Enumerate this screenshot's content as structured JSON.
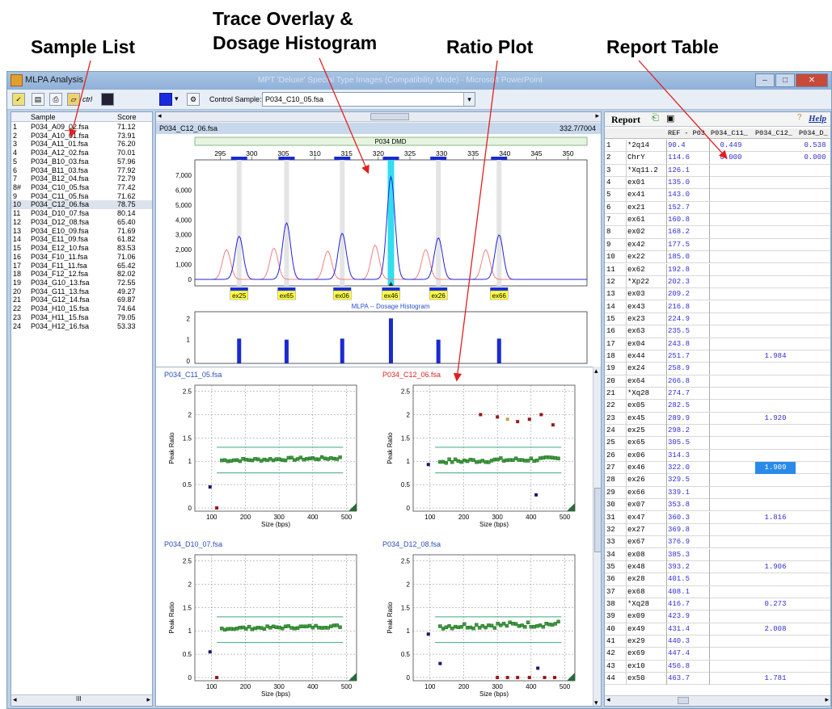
{
  "annotations": {
    "sample_list": "Sample List",
    "trace_line1": "Trace Overlay &",
    "trace_line2": "Dosage Histogram",
    "ratio_plot": "Ratio Plot",
    "report_table": "Report Table"
  },
  "window": {
    "title": "MLPA Analysis",
    "blurred_title": "MPT 'Deluxe' Special Type Images (Compatibility Mode) - Microsoft PowerPoint"
  },
  "toolbar": {
    "ctrl_label": "ctrl",
    "control_sample_label": "Control Sample:",
    "control_sample_value": "P034_C10_05.fsa"
  },
  "sample_list": {
    "headers": [
      "Sample",
      "Score"
    ],
    "rows": [
      [
        "1",
        "P034_A09_02.fsa",
        "71.12"
      ],
      [
        "2",
        "P034_A10_01.fsa",
        "73.91"
      ],
      [
        "3",
        "P034_A11_01.fsa",
        "76.20"
      ],
      [
        "4",
        "P034_A12_02.fsa",
        "70.01"
      ],
      [
        "5",
        "P034_B10_03.fsa",
        "57.96"
      ],
      [
        "6",
        "P034_B11_03.fsa",
        "77.92"
      ],
      [
        "7",
        "P034_B12_04.fsa",
        "72.79"
      ],
      [
        "8#",
        "P034_C10_05.fsa",
        "77.42"
      ],
      [
        "9",
        "P034_C11_05.fsa",
        "71.62"
      ],
      [
        "10",
        "P034_C12_06.fsa",
        "78.75"
      ],
      [
        "11",
        "P034_D10_07.fsa",
        "80.14"
      ],
      [
        "12",
        "P034_D12_08.fsa",
        "65.40"
      ],
      [
        "13",
        "P034_E10_09.fsa",
        "71.69"
      ],
      [
        "14",
        "P034_E11_09.fsa",
        "61.82"
      ],
      [
        "15",
        "P034_E12_10.fsa",
        "83.53"
      ],
      [
        "16",
        "P034_F10_11.fsa",
        "71.06"
      ],
      [
        "17",
        "P034_F11_11.fsa",
        "65.42"
      ],
      [
        "18",
        "P034_F12_12.fsa",
        "82.02"
      ],
      [
        "19",
        "P034_G10_13.fsa",
        "72.55"
      ],
      [
        "20",
        "P034_G11_13.fsa",
        "49.27"
      ],
      [
        "21",
        "P034_G12_14.fsa",
        "69.87"
      ],
      [
        "22",
        "P034_H10_15.fsa",
        "74.64"
      ],
      [
        "23",
        "P034_H11_15.fsa",
        "79.05"
      ],
      [
        "24",
        "P034_H12_16.fsa",
        "53.33"
      ]
    ],
    "selected_index": 9,
    "scroll_thumb": "III"
  },
  "trace": {
    "sample_name": "P034_C12_06.fsa",
    "counter": "332.7/7004",
    "panel_label": "P034 DMD",
    "x_ticks": [
      295,
      300,
      305,
      310,
      315,
      320,
      325,
      330,
      335,
      340,
      345,
      350
    ],
    "y_ticks": [
      "7,000",
      "6,000",
      "5,000",
      "4,000",
      "3,000",
      "2,000",
      "1,000",
      "0"
    ],
    "bins": [
      {
        "label": "ex25",
        "x": 298.0
      },
      {
        "label": "ex65",
        "x": 305.5
      },
      {
        "label": "ex06",
        "x": 314.3
      },
      {
        "label": "ex46",
        "x": 322.0
      },
      {
        "label": "ex26",
        "x": 329.5
      },
      {
        "label": "ex66",
        "x": 339.1
      }
    ],
    "highlight_x": 322.0,
    "red_peaks": [
      [
        296.0,
        2000
      ],
      [
        303.5,
        2100
      ],
      [
        312.0,
        1900
      ],
      [
        319.5,
        2300
      ],
      [
        327.5,
        2000
      ],
      [
        337.0,
        2000
      ]
    ],
    "blue_peaks": [
      [
        298.0,
        2900
      ],
      [
        305.5,
        3800
      ],
      [
        314.3,
        3100
      ],
      [
        322.0,
        6900
      ],
      [
        329.5,
        2800
      ],
      [
        339.1,
        3000
      ]
    ],
    "colors": {
      "red": "#f08080",
      "blue": "#2222dd",
      "highlight": "#33ddee",
      "bin_fill": "#ffff44"
    }
  },
  "histogram": {
    "title": "MLPA -- Dosage Histogram",
    "y_ticks": [
      "2",
      "1",
      "0"
    ],
    "bars": [
      {
        "x": 298.0,
        "v": 1.05
      },
      {
        "x": 305.5,
        "v": 1.0
      },
      {
        "x": 314.3,
        "v": 1.05
      },
      {
        "x": 322.0,
        "v": 2.0
      },
      {
        "x": 329.5,
        "v": 1.0
      },
      {
        "x": 339.1,
        "v": 1.05
      }
    ]
  },
  "ratio_plots": [
    {
      "title": "P034_C11_05.fsa",
      "title_color": "#2a4fb8",
      "outliers": [
        [
          95,
          0.45,
          "#1a1a6a"
        ],
        [
          115,
          0.0,
          "#9a1a1a"
        ]
      ],
      "green_base": 1.02,
      "green_var": 0.06
    },
    {
      "title": "P034_C12_06.fsa",
      "title_color": "#dd2222",
      "outliers": [
        [
          95,
          0.93,
          "#1a1a6a"
        ],
        [
          250,
          2.0,
          "#9a1a1a"
        ],
        [
          300,
          1.95,
          "#9a1a1a"
        ],
        [
          330,
          1.9,
          "#d0a040"
        ],
        [
          360,
          1.85,
          "#9a1a1a"
        ],
        [
          395,
          1.9,
          "#9a1a1a"
        ],
        [
          430,
          2.0,
          "#9a1a1a"
        ],
        [
          465,
          1.78,
          "#9a1a1a"
        ],
        [
          415,
          0.28,
          "#1a1a6a"
        ]
      ],
      "green_base": 1.0,
      "green_var": 0.09
    },
    {
      "title": "P034_D10_07.fsa",
      "title_color": "#2a4fb8",
      "outliers": [
        [
          95,
          0.55,
          "#1a1a6a"
        ],
        [
          115,
          0.0,
          "#9a1a1a"
        ]
      ],
      "green_base": 1.05,
      "green_var": 0.06
    },
    {
      "title": "P034_D12_08.fsa",
      "title_color": "#2a4fb8",
      "outliers": [
        [
          95,
          0.93,
          "#1a1a6a"
        ],
        [
          130,
          0.3,
          "#1a1a6a"
        ],
        [
          300,
          0.0,
          "#9a1a1a"
        ],
        [
          330,
          0.0,
          "#9a1a1a"
        ],
        [
          360,
          0.0,
          "#9a1a1a"
        ],
        [
          395,
          0.0,
          "#9a1a1a"
        ],
        [
          420,
          0.2,
          "#1a1a6a"
        ],
        [
          440,
          0.0,
          "#9a1a1a"
        ],
        [
          470,
          0.0,
          "#9a1a1a"
        ]
      ],
      "green_base": 1.1,
      "green_var": 0.12
    }
  ],
  "ratio_axis": {
    "ylabel": "Peak Ratio",
    "xlabel": "Size (bps)",
    "y_ticks": [
      "2.5",
      "2",
      "1.5",
      "1",
      "0.5",
      "0"
    ],
    "x_ticks": [
      "100",
      "200",
      "300",
      "400",
      "500"
    ],
    "ylim": [
      0,
      2.7
    ],
    "xlim": [
      50,
      530
    ],
    "band_upper": 1.3,
    "band_lower": 0.75
  },
  "report": {
    "title": "Report",
    "help": "Help",
    "headers": [
      "",
      "",
      "REF - P03",
      "P034_C11_",
      "P034_C12_",
      "P034_D_"
    ],
    "rows": [
      [
        "1",
        "*2q14",
        "90.4",
        "0.449",
        "",
        "0.538"
      ],
      [
        "2",
        "ChrY",
        "114.6",
        "0.000",
        "",
        "0.000"
      ],
      [
        "3",
        "*Xq11.2",
        "126.1",
        "",
        "",
        ""
      ],
      [
        "4",
        "ex01",
        "135.0",
        "",
        "",
        ""
      ],
      [
        "5",
        "ex41",
        "143.0",
        "",
        "",
        ""
      ],
      [
        "6",
        "ex21",
        "152.7",
        "",
        "",
        ""
      ],
      [
        "7",
        "ex61",
        "160.8",
        "",
        "",
        ""
      ],
      [
        "8",
        "ex02",
        "168.2",
        "",
        "",
        ""
      ],
      [
        "9",
        "ex42",
        "177.5",
        "",
        "",
        ""
      ],
      [
        "10",
        "ex22",
        "185.0",
        "",
        "",
        ""
      ],
      [
        "11",
        "ex62",
        "192.8",
        "",
        "",
        ""
      ],
      [
        "12",
        "*Xp22",
        "202.3",
        "",
        "",
        ""
      ],
      [
        "13",
        "ex03",
        "209.2",
        "",
        "",
        ""
      ],
      [
        "14",
        "ex43",
        "216.8",
        "",
        "",
        ""
      ],
      [
        "15",
        "ex23",
        "224.9",
        "",
        "",
        ""
      ],
      [
        "16",
        "ex63",
        "235.5",
        "",
        "",
        ""
      ],
      [
        "17",
        "ex04",
        "243.8",
        "",
        "",
        ""
      ],
      [
        "18",
        "ex44",
        "251.7",
        "",
        "1.984",
        ""
      ],
      [
        "19",
        "ex24",
        "258.9",
        "",
        "",
        ""
      ],
      [
        "20",
        "ex64",
        "266.8",
        "",
        "",
        ""
      ],
      [
        "21",
        "*Xq28",
        "274.7",
        "",
        "",
        ""
      ],
      [
        "22",
        "ex05",
        "282.5",
        "",
        "",
        ""
      ],
      [
        "23",
        "ex45",
        "289.9",
        "",
        "1.920",
        ""
      ],
      [
        "24",
        "ex25",
        "298.2",
        "",
        "",
        ""
      ],
      [
        "25",
        "ex65",
        "305.5",
        "",
        "",
        ""
      ],
      [
        "26",
        "ex06",
        "314.3",
        "",
        "",
        ""
      ],
      [
        "27",
        "ex46",
        "322.0",
        "",
        "1.909",
        ""
      ],
      [
        "28",
        "ex26",
        "329.5",
        "",
        "",
        ""
      ],
      [
        "29",
        "ex66",
        "339.1",
        "",
        "",
        ""
      ],
      [
        "30",
        "ex07",
        "353.8",
        "",
        "",
        ""
      ],
      [
        "31",
        "ex47",
        "360.3",
        "",
        "1.816",
        ""
      ],
      [
        "32",
        "ex27",
        "369.8",
        "",
        "",
        ""
      ],
      [
        "33",
        "ex67",
        "376.9",
        "",
        "",
        ""
      ],
      [
        "34",
        "ex08",
        "385.3",
        "",
        "",
        ""
      ],
      [
        "35",
        "ex48",
        "393.2",
        "",
        "1.906",
        ""
      ],
      [
        "36",
        "ex28",
        "401.5",
        "",
        "",
        ""
      ],
      [
        "37",
        "ex68",
        "408.1",
        "",
        "",
        ""
      ],
      [
        "38",
        "*Xq28",
        "416.7",
        "",
        "0.273",
        ""
      ],
      [
        "39",
        "ex09",
        "423.9",
        "",
        "",
        ""
      ],
      [
        "40",
        "ex49",
        "431.4",
        "",
        "2.008",
        ""
      ],
      [
        "41",
        "ex29",
        "440.3",
        "",
        "",
        ""
      ],
      [
        "42",
        "ex69",
        "447.4",
        "",
        "",
        ""
      ],
      [
        "43",
        "ex10",
        "456.8",
        "",
        "",
        ""
      ],
      [
        "44",
        "ex50",
        "463.7",
        "",
        "1.781",
        ""
      ]
    ],
    "highlight_row": 26
  }
}
